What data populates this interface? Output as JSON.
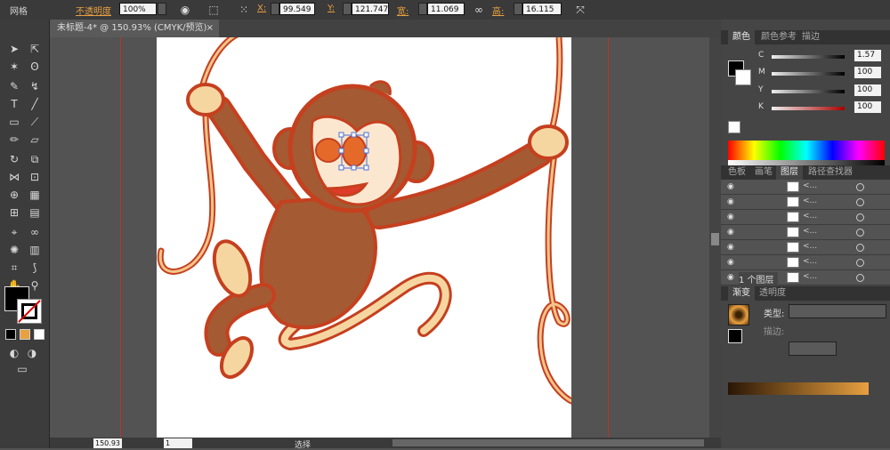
{
  "control_bar": {
    "selection_label": "网格",
    "opacity_label": "不透明度",
    "opacity_value": "100%",
    "x_label": "X:",
    "x_value": "99.549",
    "y_label": "Y:",
    "y_value": "121.747",
    "width_label": "宽:",
    "width_value": "11.069",
    "height_label": "高:",
    "height_value": "16.115"
  },
  "document": {
    "tab_title": "未标题-4* @ 150.93% (CMYK/预览)"
  },
  "color_panel": {
    "tabs": [
      "颜色",
      "颜色参考",
      "描边"
    ],
    "sliders": [
      {
        "label": "C",
        "value": "1.57"
      },
      {
        "label": "M",
        "value": "100"
      },
      {
        "label": "Y",
        "value": "100"
      },
      {
        "label": "K",
        "value": "100"
      }
    ]
  },
  "layers_panel": {
    "tabs": [
      "色板",
      "画笔",
      "图层",
      "路径查找器"
    ],
    "layers": [
      {
        "name": "<..."
      },
      {
        "name": "<..."
      },
      {
        "name": "<..."
      },
      {
        "name": "<..."
      },
      {
        "name": "<..."
      },
      {
        "name": "<..."
      },
      {
        "name": "<..."
      }
    ],
    "footer": "1 个图层"
  },
  "gradient_panel": {
    "tabs": [
      "渐变",
      "透明度"
    ],
    "type_label": "类型:",
    "stroke_label": "描边:"
  },
  "status_bar": {
    "zoom": "150.93",
    "page": "1",
    "tool": "选择"
  },
  "colors": {
    "accent": "#e8a040",
    "guide": "#c0302a"
  }
}
